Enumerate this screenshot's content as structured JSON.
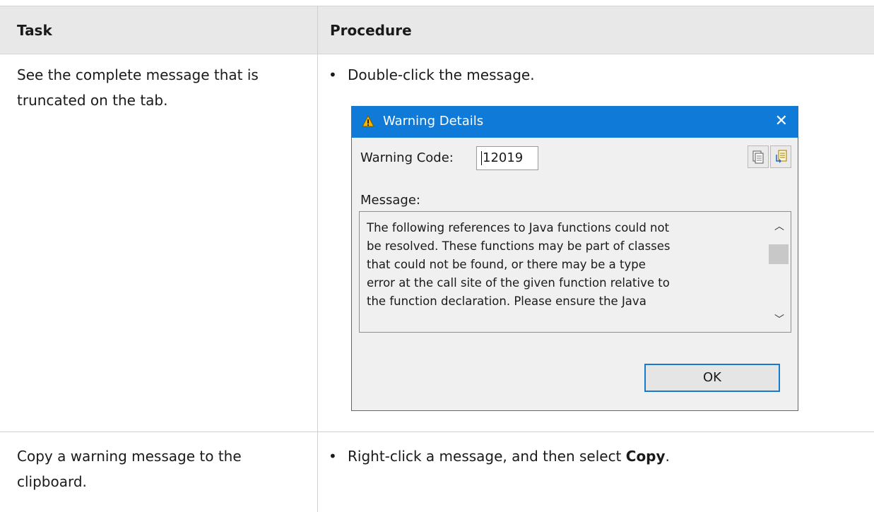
{
  "table": {
    "header": {
      "task": "Task",
      "procedure": "Procedure"
    },
    "rows": [
      {
        "task_line1": "See the complete message that is",
        "task_line2": "truncated on the tab.",
        "procedure": "Double-click the message."
      },
      {
        "task_line1": "Copy a warning message to the",
        "task_line2": "clipboard.",
        "procedure_prefix": "Right-click a message, and then select ",
        "procedure_bold": "Copy",
        "procedure_suffix": "."
      }
    ]
  },
  "dialog": {
    "title": "Warning Details",
    "close_label": "✕",
    "warning_code_label": "Warning Code:",
    "warning_code_value": "12019",
    "message_label": "Message:",
    "message_text": "The following references to Java functions could not\nbe resolved. These functions may be part of classes\nthat could not be found, or there may be a type\nerror at the call site of the given function relative to\nthe function declaration. Please ensure the Java",
    "ok_label": "OK",
    "copy_icon": "copy-icon",
    "export_icon": "export-icon",
    "colors": {
      "title_bar": "#0f7ad8",
      "border": "#1979ca"
    }
  }
}
